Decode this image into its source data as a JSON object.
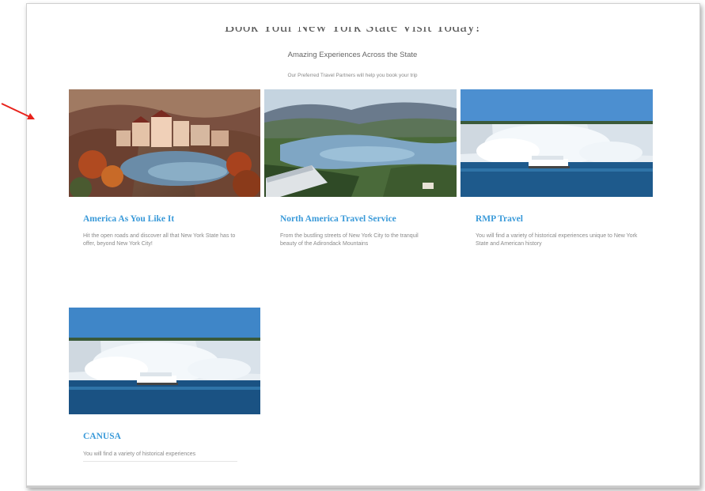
{
  "header": {
    "title": "Book Your New York State Visit Today!",
    "subtitle": "Amazing Experiences Across the State",
    "tagline": "Our Preferred Travel Partners will help you book your trip"
  },
  "annotation": {
    "arrow_color": "#e8221b"
  },
  "colors": {
    "title_accent": "#3a9ad9"
  },
  "cards": [
    {
      "image": "mountain-resort-lake-photo",
      "title": "America As You Like It",
      "description": "Hit the open roads and discover all that New York State has to offer, beyond New York City!"
    },
    {
      "image": "adirondack-lake-valley-photo",
      "title": "North America Travel Service",
      "description": "From the bustling streets of New York City to the tranquil beauty of the Adirondack Mountains"
    },
    {
      "image": "niagara-falls-boat-photo",
      "title": "RMP Travel",
      "description": "You will find a variety of historical experiences unique to New York State and American history"
    },
    {
      "image": "niagara-falls-boat-photo",
      "title": "CANUSA",
      "description": "You will find a variety of historical experiences"
    }
  ]
}
